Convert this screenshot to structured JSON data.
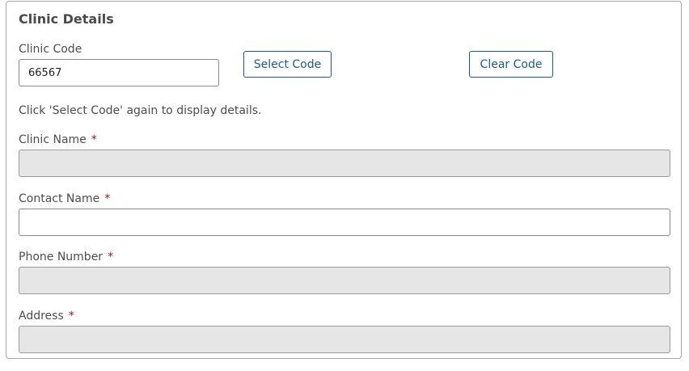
{
  "section": {
    "title": "Clinic Details"
  },
  "clinic_code": {
    "label": "Clinic Code",
    "value": "66567"
  },
  "buttons": {
    "select_code": "Select Code",
    "clear_code": "Clear Code"
  },
  "hint": "Click 'Select Code' again to display details.",
  "fields": {
    "clinic_name": {
      "label": "Clinic Name",
      "required_mark": "*",
      "value": "",
      "disabled": true
    },
    "contact_name": {
      "label": "Contact Name",
      "required_mark": "*",
      "value": "",
      "disabled": false
    },
    "phone_number": {
      "label": "Phone Number",
      "required_mark": "*",
      "value": "",
      "disabled": true
    },
    "address": {
      "label": "Address",
      "required_mark": "*",
      "value": "",
      "disabled": true
    }
  },
  "colors": {
    "accent": "#1a5a96",
    "required": "#a4161a",
    "disabled_bg": "#e6e6e6"
  }
}
